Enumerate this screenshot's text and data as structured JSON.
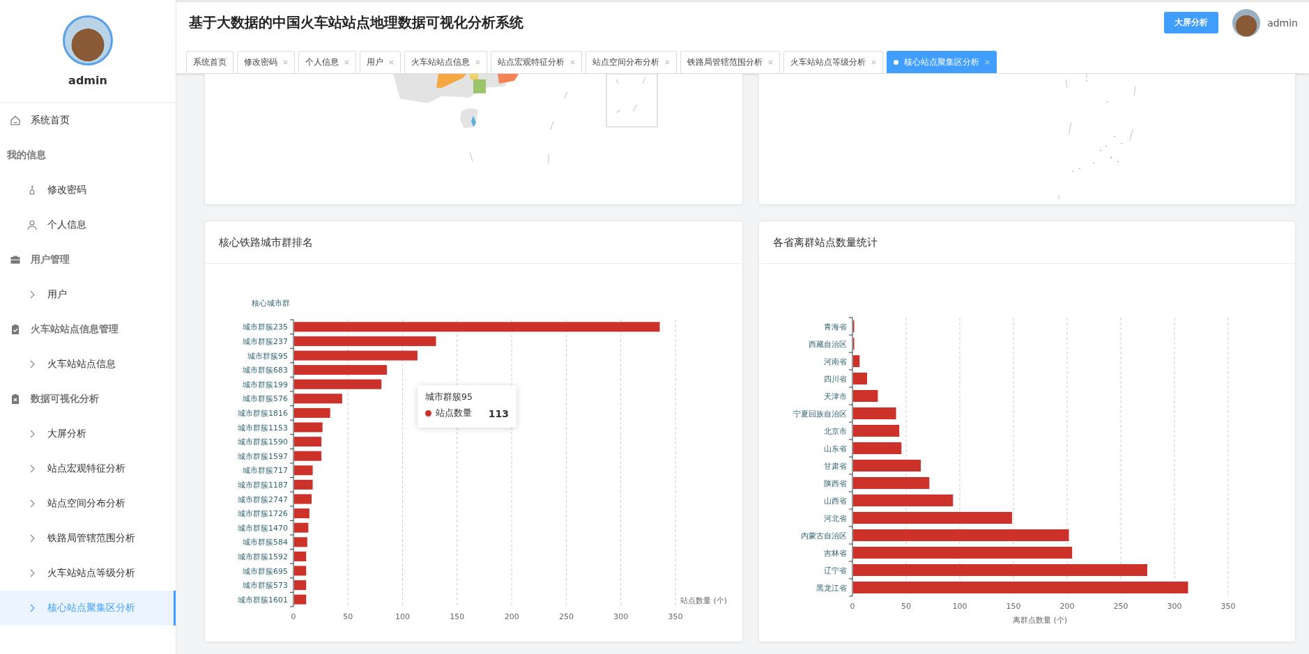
{
  "sidebar": {
    "user": "admin",
    "menu": [
      {
        "kind": "item",
        "label": "系统首页",
        "selected": false
      },
      {
        "kind": "group",
        "label": "我的信息",
        "children": [
          {
            "label": "修改密码",
            "selected": false
          },
          {
            "label": "个人信息",
            "selected": false
          }
        ]
      },
      {
        "kind": "group",
        "label": "用户管理",
        "children": [
          {
            "label": "用户",
            "selected": false
          }
        ]
      },
      {
        "kind": "group",
        "label": "火车站站点信息管理",
        "children": [
          {
            "label": "火车站站点信息",
            "selected": false
          }
        ]
      },
      {
        "kind": "group",
        "label": "数据可视化分析",
        "children": [
          {
            "label": "大屏分析",
            "selected": false
          },
          {
            "label": "站点宏观特征分析",
            "selected": false
          },
          {
            "label": "站点空间分布分析",
            "selected": false
          },
          {
            "label": "铁路局管辖范围分析",
            "selected": false
          },
          {
            "label": "火车站站点等级分析",
            "selected": false
          },
          {
            "label": "核心站点聚集区分析",
            "selected": true
          }
        ]
      }
    ]
  },
  "header": {
    "title": "基于大数据的中国火车站站点地理数据可视化分析系统",
    "big_screen_button": "大屏分析",
    "user": "admin"
  },
  "tabs": [
    {
      "label": "系统首页",
      "closable": false,
      "selected": false
    },
    {
      "label": "修改密码",
      "closable": true,
      "selected": false
    },
    {
      "label": "个人信息",
      "closable": true,
      "selected": false
    },
    {
      "label": "用户",
      "closable": true,
      "selected": false
    },
    {
      "label": "火车站站点信息",
      "closable": true,
      "selected": false
    },
    {
      "label": "站点宏观特征分析",
      "closable": true,
      "selected": false
    },
    {
      "label": "站点空间分布分析",
      "closable": true,
      "selected": false
    },
    {
      "label": "铁路局管辖范围分析",
      "closable": true,
      "selected": false
    },
    {
      "label": "火车站站点等级分析",
      "closable": true,
      "selected": false
    },
    {
      "label": "核心站点聚集区分析",
      "closable": true,
      "selected": true
    }
  ],
  "charts": [
    {
      "title": "核心铁路城市群排名",
      "chart_data": {
        "type": "bar",
        "orientation": "horizontal",
        "ylabel": "核心城市群",
        "xlabel": "站点数量 (个)",
        "categories": [
          "城市群簇235",
          "城市群簇237",
          "城市群簇95",
          "城市群簇683",
          "城市群簇199",
          "城市群簇576",
          "城市群簇1816",
          "城市群簇1153",
          "城市群簇1590",
          "城市群簇1597",
          "城市群簇717",
          "城市群簇1187",
          "城市群簇2747",
          "城市群簇1726",
          "城市群簇1470",
          "城市群簇584",
          "城市群簇1592",
          "城市群簇695",
          "城市群簇573",
          "城市群簇1601"
        ],
        "series": [
          {
            "name": "站点数量",
            "color": "#cc3229",
            "values": [
              335,
              130,
              113,
              85,
              80,
              44,
              33,
              26,
              25,
              25,
              17,
              17,
              16,
              14,
              13,
              12,
              11,
              11,
              11,
              11
            ]
          }
        ],
        "xlim": [
          0,
          350
        ],
        "xticks": [
          0,
          50,
          100,
          150,
          200,
          250,
          300,
          350
        ],
        "grid": true
      },
      "tooltip": {
        "title": "城市群簇95",
        "value": "113"
      }
    },
    {
      "title": "各省离群站点数量统计",
      "chart_data": {
        "type": "bar",
        "orientation": "horizontal",
        "xlabel": "离群点数量 (个)",
        "categories": [
          "青海省",
          "西藏自治区",
          "河南省",
          "四川省",
          "天津市",
          "宁夏回族自治区",
          "北京市",
          "山东省",
          "甘肃省",
          "陕西省",
          "山西省",
          "河北省",
          "内蒙古自治区",
          "吉林省",
          "辽宁省",
          "黑龙江省"
        ],
        "series": [
          {
            "color": "#cc3229",
            "values": [
              1,
              1,
              6,
              13,
              23,
              40,
              43,
              45,
              63,
              71,
              93,
              148,
              201,
              204,
              274,
              312
            ]
          }
        ],
        "xlim": [
          0,
          350
        ],
        "xticks": [
          0,
          50,
          100,
          150,
          200,
          250,
          300,
          350
        ],
        "grid": true
      }
    }
  ]
}
